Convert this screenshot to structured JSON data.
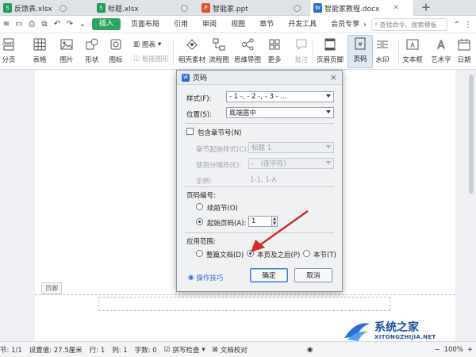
{
  "tabs": [
    {
      "label": "反馈表.xlsx",
      "type": "xlsx"
    },
    {
      "label": "标题.xlsx",
      "type": "xlsx"
    },
    {
      "label": "智能家.ppt",
      "type": "ppt"
    },
    {
      "label": "智能家教程.docx",
      "type": "docx",
      "active": true
    }
  ],
  "menu": {
    "items": [
      "插入",
      "页面布局",
      "引用",
      "审阅",
      "视图",
      "章节",
      "开发工具",
      "会员专享"
    ],
    "active": "插入",
    "search_placeholder": "查找命令、搜索模板"
  },
  "tools": {
    "fenye": "分页",
    "biaoge": "表格",
    "tupian": "图片",
    "xingzhuang": "形状",
    "tubiao": "图标",
    "tubiao2": "图表",
    "zhinengtuxing": "智能图形",
    "daoke": "稻壳素材",
    "liuchengtu": "流程图",
    "siweidaotu": "思维导图",
    "gengduo": "更多",
    "pizhu": "批注",
    "yemeiyejiao": "页眉页脚",
    "yema": "页码",
    "shuiyin": "水印",
    "wenbenkuang": "文本框",
    "yishuzi": "艺术字",
    "riqi": "日期"
  },
  "document": {
    "footer_label": "页脚"
  },
  "dialog": {
    "title": "页码",
    "style_label": "样式(F):",
    "style_value": "- 1 -, - 2 -, - 3 - ...",
    "position_label": "位置(S):",
    "position_value": "底端居中",
    "include_chapter": "包含章节号(N)",
    "chapter_start_label": "章节起始样式(C):",
    "chapter_start_value": "标题 1",
    "separator_label": "使用分隔符(E):",
    "separator_value": "-　(连字符)",
    "example_label": "示例:",
    "example_value": "1-1, 1-A",
    "numbering_section": "页码编号:",
    "continue_label": "续前节(O)",
    "start_label": "起始页码(A):",
    "start_value": "1",
    "scope_section": "应用范围:",
    "scope_whole": "整篇文档(D)",
    "scope_this_after": "本页及之后(P)",
    "scope_section_only": "本节(T)",
    "tips": "操作技巧",
    "ok": "确定",
    "cancel": "取消"
  },
  "status": {
    "section": "节: 1/1",
    "setting": "设置值: 27.5厘米",
    "row": "行: 1",
    "col": "列: 1",
    "words": "字数: 0",
    "spell": "拼写检查",
    "proof": "文档校对",
    "zoom": "100%"
  },
  "watermark": {
    "title": "系统之家",
    "url": "XITONGZHIJIA.NET"
  }
}
